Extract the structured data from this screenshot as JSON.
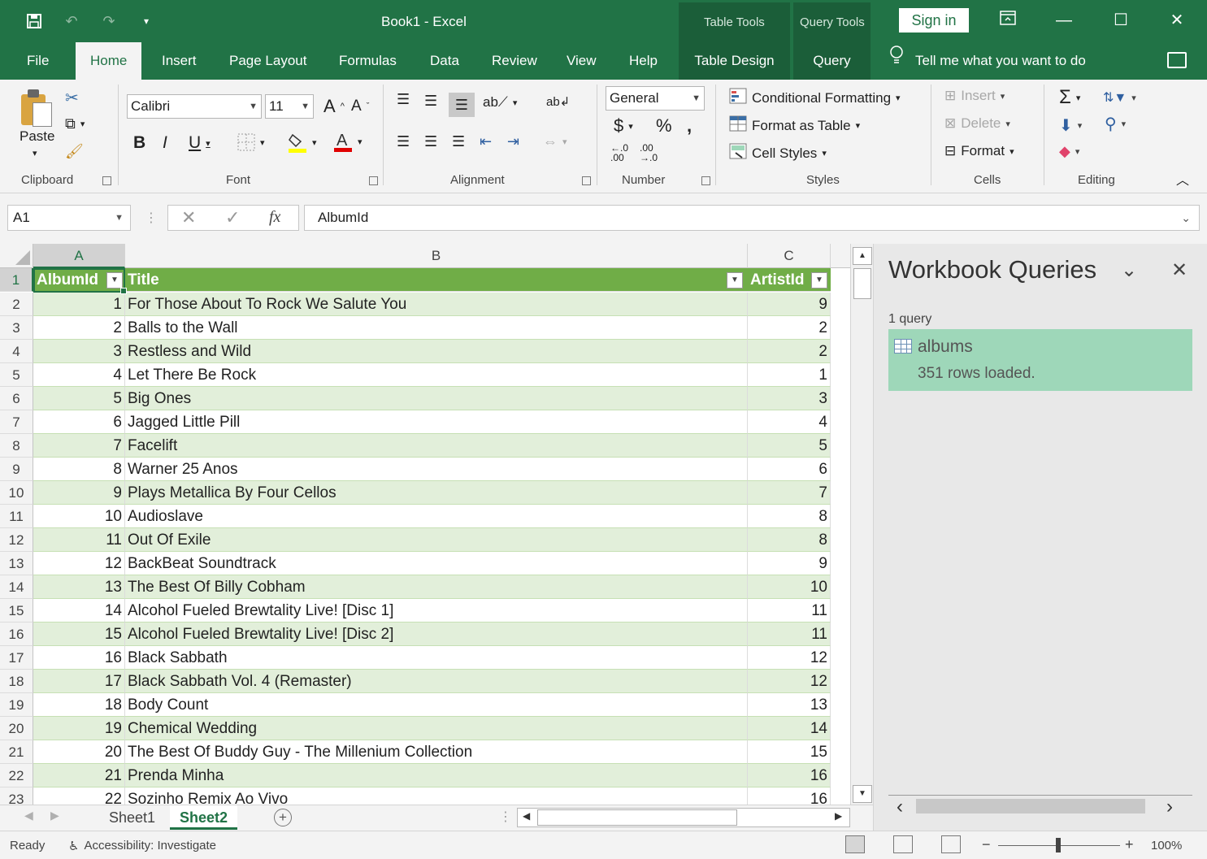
{
  "app": {
    "title": "Book1  -  Excel",
    "sign_in": "Sign in"
  },
  "context_groups": {
    "table_tools": "Table Tools",
    "query_tools": "Query Tools"
  },
  "tabs": [
    "File",
    "Home",
    "Insert",
    "Page Layout",
    "Formulas",
    "Data",
    "Review",
    "View",
    "Help",
    "Table Design",
    "Query"
  ],
  "tell_me": "Tell me what you want to do",
  "ribbon": {
    "clipboard": {
      "label": "Clipboard",
      "paste": "Paste"
    },
    "font": {
      "label": "Font",
      "name": "Calibri",
      "size": "11"
    },
    "alignment": {
      "label": "Alignment"
    },
    "number": {
      "label": "Number",
      "format": "General",
      "currency": "$",
      "percent": "%",
      "comma": ",",
      "inc_decimal": "←.0 .00",
      "dec_decimal": ".00 →.0"
    },
    "styles": {
      "label": "Styles",
      "conditional": "Conditional Formatting",
      "format_table": "Format as Table",
      "cell_styles": "Cell Styles"
    },
    "cells": {
      "label": "Cells",
      "insert": "Insert",
      "delete": "Delete",
      "format": "Format"
    },
    "editing": {
      "label": "Editing"
    }
  },
  "formula_bar": {
    "name_box": "A1",
    "fx": "fx",
    "content": "AlbumId"
  },
  "columns": [
    "A",
    "B",
    "C"
  ],
  "table": {
    "headers": [
      "AlbumId",
      "Title",
      "ArtistId"
    ],
    "rows": [
      [
        "1",
        "For Those About To Rock We Salute You",
        "9"
      ],
      [
        "2",
        "Balls to the Wall",
        "2"
      ],
      [
        "3",
        "Restless and Wild",
        "2"
      ],
      [
        "4",
        "Let There Be Rock",
        "1"
      ],
      [
        "5",
        "Big Ones",
        "3"
      ],
      [
        "6",
        "Jagged Little Pill",
        "4"
      ],
      [
        "7",
        "Facelift",
        "5"
      ],
      [
        "8",
        "Warner 25 Anos",
        "6"
      ],
      [
        "9",
        "Plays Metallica By Four Cellos",
        "7"
      ],
      [
        "10",
        "Audioslave",
        "8"
      ],
      [
        "11",
        "Out Of Exile",
        "8"
      ],
      [
        "12",
        "BackBeat Soundtrack",
        "9"
      ],
      [
        "13",
        "The Best Of Billy Cobham",
        "10"
      ],
      [
        "14",
        "Alcohol Fueled Brewtality Live! [Disc 1]",
        "11"
      ],
      [
        "15",
        "Alcohol Fueled Brewtality Live! [Disc 2]",
        "11"
      ],
      [
        "16",
        "Black Sabbath",
        "12"
      ],
      [
        "17",
        "Black Sabbath Vol. 4 (Remaster)",
        "12"
      ],
      [
        "18",
        "Body Count",
        "13"
      ],
      [
        "19",
        "Chemical Wedding",
        "14"
      ],
      [
        "20",
        "The Best Of Buddy Guy - The Millenium Collection",
        "15"
      ],
      [
        "21",
        "Prenda Minha",
        "16"
      ],
      [
        "22",
        "Sozinho Remix Ao Vivo",
        "16"
      ]
    ]
  },
  "sheets": [
    {
      "name": "Sheet1",
      "active": false
    },
    {
      "name": "Sheet2",
      "active": true
    }
  ],
  "status": {
    "ready": "Ready",
    "accessibility": "Accessibility: Investigate",
    "zoom": "100%"
  },
  "queries_pane": {
    "title": "Workbook Queries",
    "count": "1 query",
    "query_name": "albums",
    "query_status": "351 rows loaded."
  },
  "colors": {
    "brand": "#217346",
    "table_header": "#70ad47",
    "band": "#e2efda",
    "query_item": "#9ed7b9"
  }
}
